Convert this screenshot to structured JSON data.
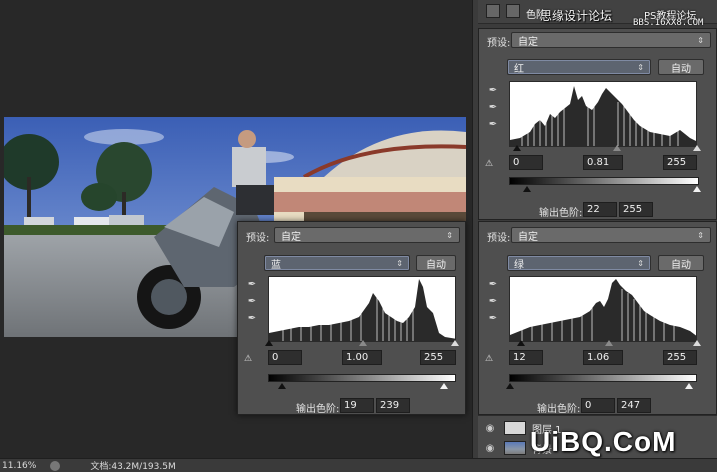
{
  "status": {
    "zoom": "11.16%",
    "doc_label": "文档:43.2M/193.5M"
  },
  "watermark": {
    "line1": "思缘设计论坛",
    "line2": "PS教程论坛",
    "line3": "BBS.16XX8.COM",
    "big": "UiBQ.CoM"
  },
  "panel_header": {
    "tab_label": "色阶"
  },
  "panels": {
    "red": {
      "preset_label": "预设:",
      "preset_value": "自定",
      "channel": "红",
      "auto_label": "自动",
      "input_black": "0",
      "input_gamma": "0.81",
      "input_white": "255",
      "output_label": "输出色阶:",
      "output_black": "22",
      "output_white": "255"
    },
    "blue": {
      "preset_label": "预设:",
      "preset_value": "自定",
      "channel": "蓝",
      "auto_label": "自动",
      "input_black": "0",
      "input_gamma": "1.00",
      "input_white": "255",
      "output_label": "输出色阶:",
      "output_black": "19",
      "output_white": "239"
    },
    "green": {
      "preset_label": "预设:",
      "preset_value": "自定",
      "channel": "绿",
      "auto_label": "自动",
      "input_black": "12",
      "input_gamma": "1.06",
      "input_white": "255",
      "output_label": "输出色阶:",
      "output_black": "0",
      "output_white": "247"
    }
  },
  "layers": [
    {
      "name": "图层 1"
    },
    {
      "name": "背景"
    }
  ],
  "icons": {
    "eyedropper": "eyedropper-icon",
    "eye": "eye-icon",
    "clip": "clip-warning-icon"
  },
  "colors": {
    "panel_bg": "#4f4f4f",
    "app_bg": "#282828",
    "histogram_bg": "#ffffff"
  }
}
